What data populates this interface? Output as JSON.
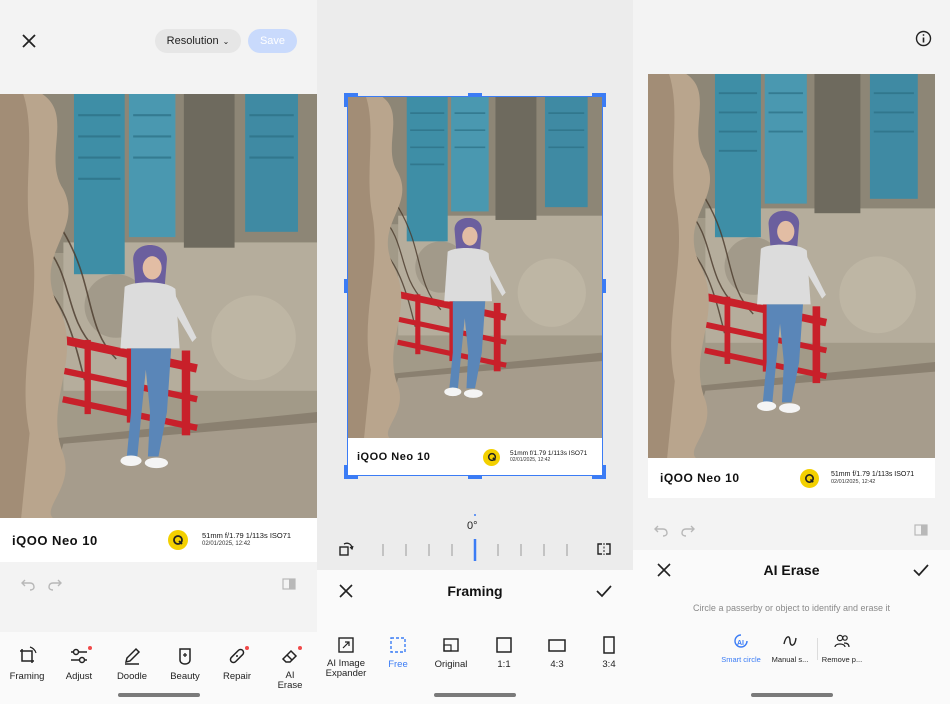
{
  "editor": {
    "resolution_label": "Resolution",
    "save_label": "Save",
    "tools": [
      {
        "label": "Framing"
      },
      {
        "label": "Adjust"
      },
      {
        "label": "Doodle"
      },
      {
        "label": "Beauty"
      },
      {
        "label": "Repair"
      },
      {
        "label": "AI\nErase"
      }
    ]
  },
  "watermark": {
    "brand": "iQOO Neo 10",
    "specs": "51mm  f/1.79  1/113s  ISO71",
    "date": "02/01/2025, 12:42"
  },
  "framing": {
    "title": "Framing",
    "angle": "0°",
    "options": [
      {
        "label": "AI Image\nExpander"
      },
      {
        "label": "Free"
      },
      {
        "label": "Original"
      },
      {
        "label": "1:1"
      },
      {
        "label": "4:3"
      },
      {
        "label": "3:4"
      }
    ],
    "selected": "Free"
  },
  "ai_erase": {
    "title": "AI Erase",
    "hint": "Circle a passerby or object to identify and erase it",
    "modes": [
      {
        "label": "Smart circle"
      },
      {
        "label": "Manual s..."
      },
      {
        "label": "Remove p..."
      }
    ],
    "selected": "Smart circle"
  },
  "colors": {
    "accent": "#3b7cf5",
    "save_disabled": "#c9dafc",
    "logo_yellow": "#f3d000",
    "rail_red": "#c8202a",
    "shutter_teal": "#3e8ea6"
  }
}
